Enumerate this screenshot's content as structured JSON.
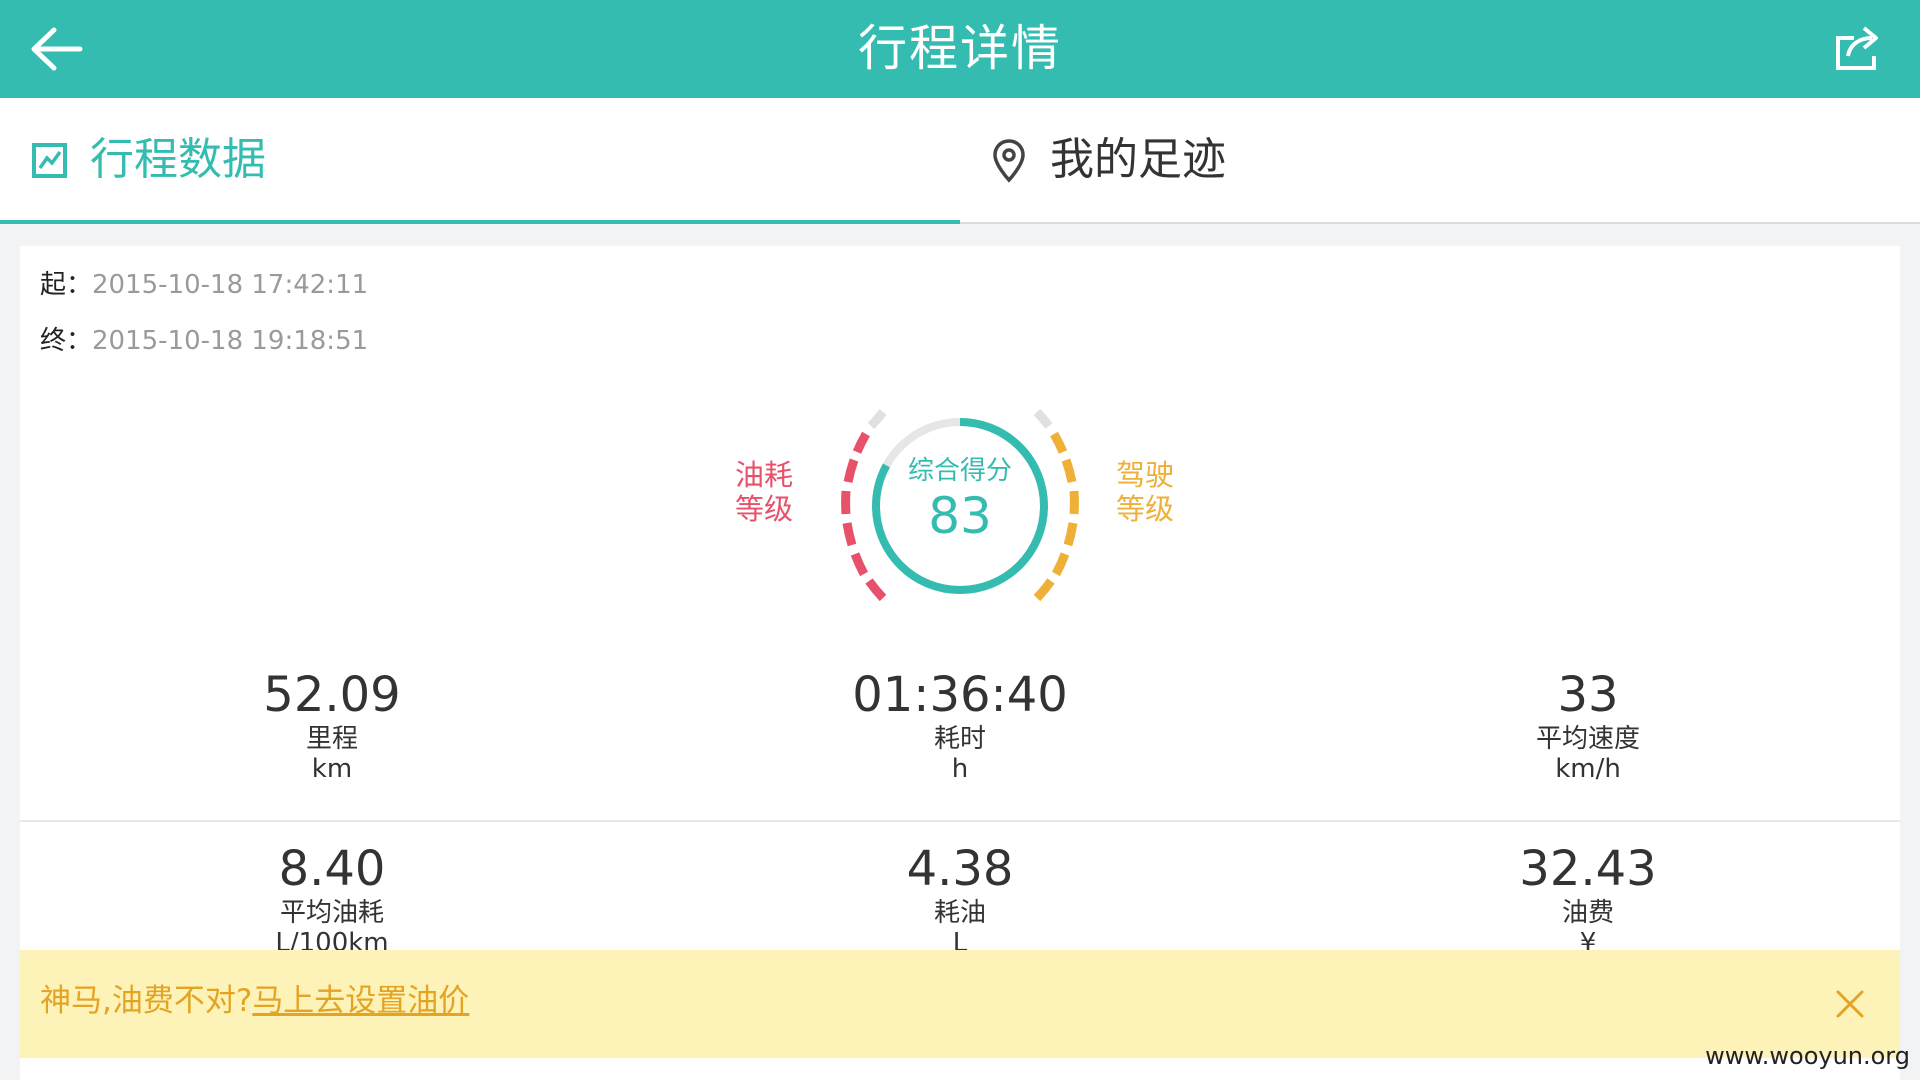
{
  "header": {
    "title": "行程详情",
    "back_icon": "back-arrow-icon",
    "share_icon": "share-icon"
  },
  "tabs": [
    {
      "label": "行程数据",
      "icon": "chart-icon",
      "active": true
    },
    {
      "label": "我的足迹",
      "icon": "location-pin-icon",
      "active": false
    }
  ],
  "trip": {
    "start_label": "起：",
    "start_time": "2015-10-18 17:42:11",
    "end_label": "终：",
    "end_time": "2015-10-18 19:18:51"
  },
  "score": {
    "label": "综合得分",
    "value": "83",
    "fuel_label_line1": "油耗",
    "fuel_label_line2": "等级",
    "drive_label_line1": "驾驶",
    "drive_label_line2": "等级",
    "score_fraction": 0.83
  },
  "stats": [
    {
      "value": "52.09",
      "name": "里程",
      "unit": "km"
    },
    {
      "value": "01:36:40",
      "name": "耗时",
      "unit": "h"
    },
    {
      "value": "33",
      "name": "平均速度",
      "unit": "km/h"
    },
    {
      "value": "8.40",
      "name": "平均油耗",
      "unit": "L/100km"
    },
    {
      "value": "4.38",
      "name": "耗油",
      "unit": "L"
    },
    {
      "value": "32.43",
      "name": "油费",
      "unit": "¥"
    }
  ],
  "banner": {
    "text": "神马,油费不对?",
    "link": "马上去设置油价",
    "close_icon": "close-icon"
  },
  "watermark": "www.wooyun.org",
  "colors": {
    "primary": "#35bcb0",
    "fuel": "#e8516a",
    "drive": "#efb038",
    "banner_bg": "#fdf2b8"
  }
}
